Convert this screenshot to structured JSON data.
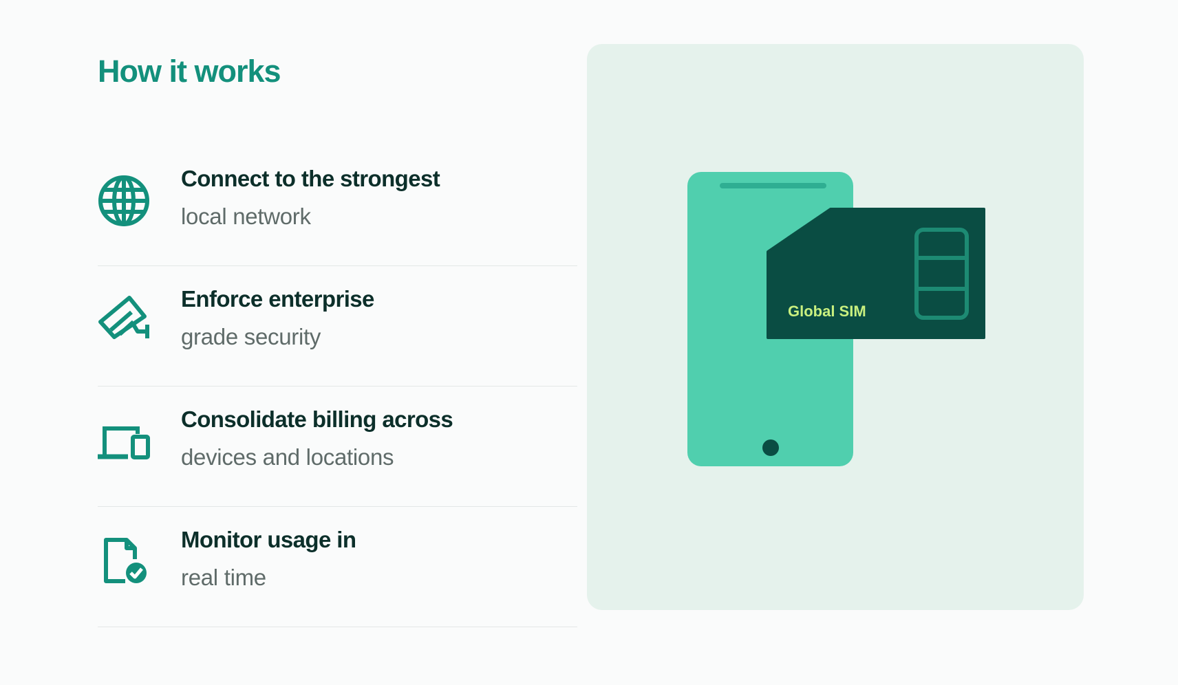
{
  "title": "How it works",
  "features": [
    {
      "heading": "Connect to the strongest",
      "sub": "local network",
      "icon": "globe-icon"
    },
    {
      "heading": "Enforce enterprise",
      "sub": "grade security",
      "icon": "security-camera-icon"
    },
    {
      "heading": "Consolidate billing across",
      "sub": "devices and locations",
      "icon": "devices-icon"
    },
    {
      "heading": "Monitor usage in",
      "sub": "real time",
      "icon": "document-check-icon"
    }
  ],
  "illustration": {
    "sim_label": "Global SIM"
  },
  "colors": {
    "accent": "#13907c",
    "heading": "#0c2f2a",
    "subtext": "#5f6b69",
    "panel": "#e5f2ec",
    "phone": "#50cfae",
    "sim": "#0a4d43",
    "sim_label": "#c9f07f"
  }
}
